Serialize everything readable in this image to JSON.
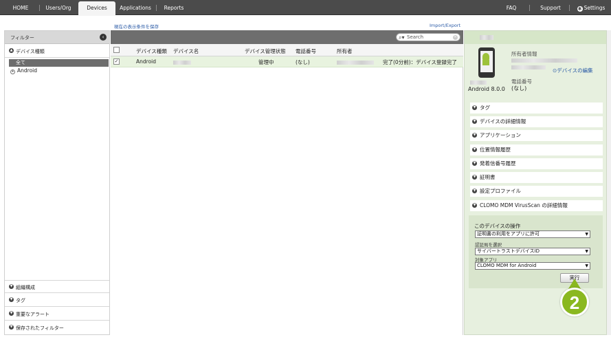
{
  "nav": {
    "items": [
      "HOME",
      "Users/Org",
      "Devices",
      "Applications",
      "Reports"
    ],
    "right": [
      "FAQ",
      "Support",
      "Settings"
    ]
  },
  "links": {
    "save_view": "現在の表示条件を保存",
    "import_export": "Import/Export"
  },
  "filter": {
    "title": "フィルター",
    "device_type": "デバイス種類",
    "all": "全て",
    "android": "Android",
    "bottom_sections": [
      "組織構成",
      "タグ",
      "重要なアラート",
      "保存されたフィルター"
    ]
  },
  "table": {
    "search_placeholder": "Search",
    "headers": [
      "デバイス種類",
      "デバイス名",
      "デバイス管理状態",
      "電話番号",
      "所有者"
    ],
    "row": {
      "type": "Android",
      "status": "管理中",
      "phone": "(なし)",
      "note": "完了(0分前)：デバイス登録完了"
    }
  },
  "detail": {
    "owner_label": "所有者情報",
    "edit_link": "デバイスの編集",
    "os": "Android 8.0.0",
    "phone_label": "電話番号",
    "phone_value": "(なし)",
    "sections": [
      "タグ",
      "デバイスの詳細情報",
      "アプリケーション",
      "位置情報履歴",
      "発着信番号履歴",
      "証明書",
      "設定プロファイル",
      "CLOMO MDM VirusScan の詳細情報"
    ],
    "ops": {
      "title": "このデバイスの操作",
      "action": "証明書の利用をアプリに許可",
      "cert_label": "認証局を選択",
      "cert_value": "サイバートラストデバイスID",
      "app_label": "対象アプリ",
      "app_value": "CLOMO MDM for Android",
      "execute": "実行"
    }
  },
  "badge": "2",
  "colors": {
    "accent_green": "#8ab820",
    "nav_bg": "#4b4b4b",
    "link": "#2a5aa6"
  }
}
